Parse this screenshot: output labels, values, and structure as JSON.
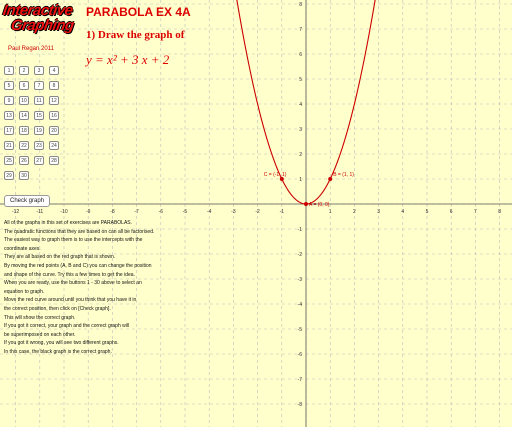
{
  "logo": {
    "line1": "Interactive",
    "line2": "Graphing"
  },
  "author": "Paul Regan 2011",
  "header": {
    "title": "PARABOLA EX 4A",
    "task": "1) Draw the graph of",
    "equation": "y = x² + 3 x + 2"
  },
  "buttons": [
    "1",
    "2",
    "3",
    "4",
    "5",
    "6",
    "7",
    "8",
    "9",
    "10",
    "11",
    "12",
    "13",
    "14",
    "15",
    "16",
    "17",
    "18",
    "19",
    "20",
    "21",
    "22",
    "23",
    "24",
    "25",
    "26",
    "27",
    "28",
    "29",
    "30"
  ],
  "check_button": "Check graph",
  "notes": [
    "All of the graphs in this set of exercises are PARABOLAS.",
    "The quadratic functions that they are based on can all be factorised.",
    "The easiest way to graph them is to use the intercepts with the",
    "coordinate axes.",
    "They are all based on the red graph that is shown.",
    "By moving the red points (A, B and C) you can change the position",
    "and shape of the curve.  Try this a few times to get the idea.",
    "When you are ready, use the buttons 1 - 30 above to select an",
    "equation to graph.",
    "Move the red curve around until you think that you have it in",
    "the correct position, then click on [Check graph].",
    "This will show the correct graph.",
    "If you got it correct, your graph and the correct graph will",
    "be superimposed on each other.",
    "If you got it wrong, you will see two different graphs.",
    "In this case, the black graph is the correct graph."
  ],
  "graph": {
    "x_ticks": [
      "-12",
      "-11",
      "-10",
      "-9",
      "-8",
      "-7",
      "-6",
      "-5",
      "-4",
      "-3",
      "-2",
      "-1",
      "1",
      "2",
      "3",
      "4",
      "5",
      "6",
      "7",
      "8",
      "9",
      "10"
    ],
    "y_ticks_pos": [
      "8",
      "7",
      "6",
      "5",
      "4",
      "3",
      "2",
      "1"
    ],
    "y_ticks_neg": [
      "-1",
      "-2",
      "-3",
      "-4",
      "-5",
      "-6",
      "-7",
      "-8"
    ],
    "points": [
      {
        "name": "C",
        "label": "C = (-1, 1)",
        "x": -1,
        "y": 1
      },
      {
        "name": "B",
        "label": "B = (1, 1)",
        "x": 1,
        "y": 1
      },
      {
        "name": "A",
        "label": "A = (0, 0)",
        "x": 0,
        "y": 0
      }
    ],
    "curve": "y = x^2",
    "curve_color": "#cc0000",
    "grid_color": "#bbbbbb"
  }
}
